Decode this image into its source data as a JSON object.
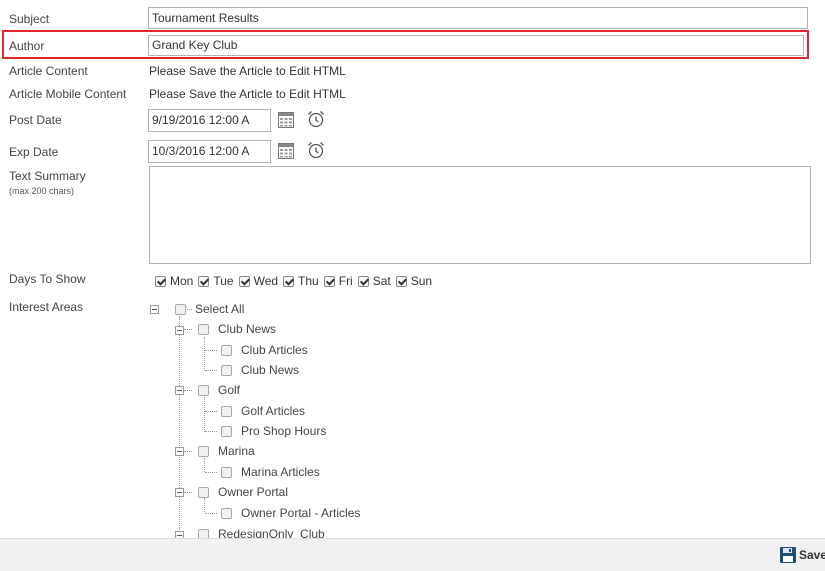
{
  "form": {
    "subject": {
      "label": "Subject",
      "value": "Tournament Results"
    },
    "author": {
      "label": "Author",
      "value": "Grand Key Club"
    },
    "article_content": {
      "label": "Article Content",
      "value": "Please Save the Article to Edit HTML"
    },
    "article_mobile_content": {
      "label": "Article Mobile Content",
      "value": "Please Save the Article to Edit HTML"
    },
    "post_date": {
      "label": "Post Date",
      "value": "9/19/2016 12:00 A"
    },
    "exp_date": {
      "label": "Exp Date",
      "value": "10/3/2016 12:00 A"
    },
    "text_summary": {
      "label": "Text Summary",
      "sublabel": "(max 200 chars)",
      "value": ""
    },
    "days_to_show": {
      "label": "Days To Show",
      "days": [
        {
          "label": "Mon",
          "checked": true
        },
        {
          "label": "Tue",
          "checked": true
        },
        {
          "label": "Wed",
          "checked": true
        },
        {
          "label": "Thu",
          "checked": true
        },
        {
          "label": "Fri",
          "checked": true
        },
        {
          "label": "Sat",
          "checked": true
        },
        {
          "label": "Sun",
          "checked": true
        }
      ]
    },
    "interest_areas": {
      "label": "Interest Areas",
      "tree": [
        {
          "label": "Select All",
          "checked": false
        },
        {
          "label": "Club News",
          "checked": false
        },
        {
          "label": "Club Articles",
          "checked": false
        },
        {
          "label": "Club News",
          "checked": false
        },
        {
          "label": "Golf",
          "checked": false
        },
        {
          "label": "Golf Articles",
          "checked": false
        },
        {
          "label": "Pro Shop Hours",
          "checked": false
        },
        {
          "label": "Marina",
          "checked": false
        },
        {
          "label": "Marina Articles",
          "checked": false
        },
        {
          "label": "Owner Portal",
          "checked": false
        },
        {
          "label": "Owner Portal - Articles",
          "checked": false
        },
        {
          "label": "RedesignOnly_Club",
          "checked": false
        }
      ]
    }
  },
  "footer": {
    "save_label": "Save"
  },
  "colors": {
    "highlight": "#e2262d",
    "footer_bg": "#f1f1f1",
    "save_icon": "#1f4e79"
  },
  "icons": {
    "calendar": "calendar-icon",
    "clock": "alarm-clock-icon",
    "save": "floppy-disk-icon",
    "tree_toggle": "collapse-minus-icon"
  }
}
